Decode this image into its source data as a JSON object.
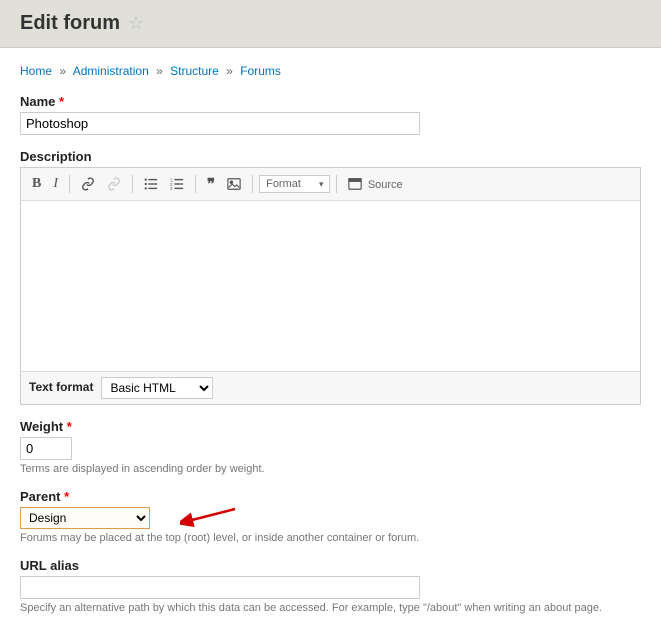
{
  "header": {
    "title": "Edit forum"
  },
  "breadcrumb": {
    "items": [
      "Home",
      "Administration",
      "Structure",
      "Forums"
    ]
  },
  "form": {
    "name": {
      "label": "Name",
      "value": "Photoshop"
    },
    "description": {
      "label": "Description"
    },
    "toolbar": {
      "format_dropdown": "Format",
      "source": "Source"
    },
    "text_format": {
      "label": "Text format",
      "value": "Basic HTML"
    },
    "weight": {
      "label": "Weight",
      "value": "0",
      "help": "Terms are displayed in ascending order by weight."
    },
    "parent": {
      "label": "Parent",
      "value": "Design",
      "help": "Forums may be placed at the top (root) level, or inside another container or forum."
    },
    "url_alias": {
      "label": "URL alias",
      "value": "",
      "help": "Specify an alternative path by which this data can be accessed. For example, type \"/about\" when writing an about page."
    }
  }
}
